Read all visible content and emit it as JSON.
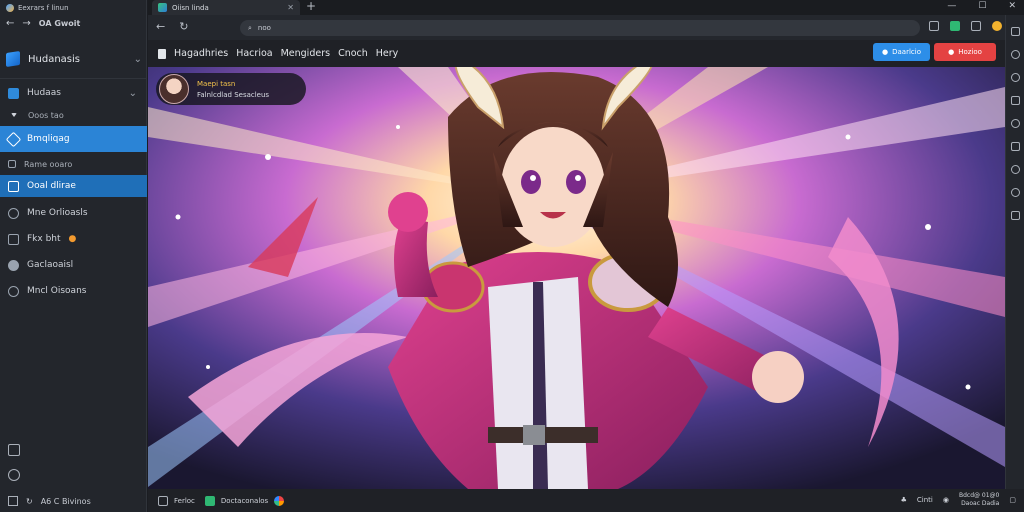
{
  "sidebar": {
    "title": "Eexrars f linun",
    "nav_user": "OA Gwoit",
    "workspace": "Hudanasis",
    "items": [
      {
        "label": "Hudaas",
        "icon": "folder-icon"
      },
      {
        "label": "Ooos tao",
        "icon": "caret-icon"
      },
      {
        "label": "Bmqliqag",
        "icon": "blocks-icon",
        "active": true
      },
      {
        "label": "Rame ooaro",
        "icon": "box-icon"
      },
      {
        "label": "Ooal dlirae",
        "icon": "window-icon",
        "selected": true
      },
      {
        "label": "Mne Orlioasls",
        "icon": "globe-icon"
      },
      {
        "label": "Fkx bht",
        "icon": "sync-icon"
      },
      {
        "label": "Gaclaoaisl",
        "icon": "shield-icon"
      },
      {
        "label": "Mncl Oisoans",
        "icon": "gear-icon"
      }
    ],
    "status_left": "A6 C Bivinos"
  },
  "browser": {
    "tab_title": "Oiisn linda",
    "url": "noo"
  },
  "menu": {
    "items": [
      "Hagadhries",
      "Hacrioa",
      "Mengiders",
      "Cnoch",
      "Hery"
    ],
    "blue_button": "Daarlcio",
    "red_button": "Hozioo"
  },
  "profile": {
    "name": "Maepi tasn",
    "subtitle": "Falnlcdlad Sesacleus"
  },
  "statusbar": {
    "item1": "Ferloc",
    "item2": "Doctaconalos",
    "right_label": "Cinti",
    "clock_top": "Bdcd@ 01@0",
    "clock_bottom": "Daoac Dadia"
  },
  "colors": {
    "accent": "#2b84d6",
    "button_blue": "#2d8ee8",
    "button_red": "#e44242",
    "profile_name": "#f3c34b"
  }
}
